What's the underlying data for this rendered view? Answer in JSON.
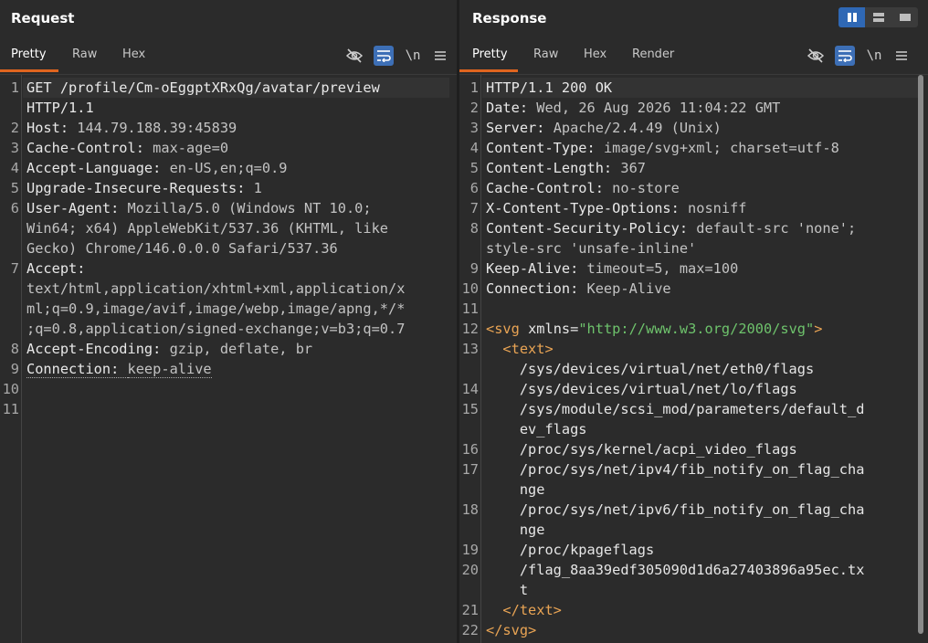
{
  "request": {
    "title": "Request",
    "tabs": [
      "Pretty",
      "Raw",
      "Hex"
    ],
    "newline_label": "\\n",
    "lines": [
      {
        "n": "1",
        "parts": [
          [
            "k",
            "GET /profile/Cm-oEggptXRxQg/avatar/preview"
          ]
        ]
      },
      {
        "n": "",
        "parts": [
          [
            "k",
            "HTTP/1.1"
          ]
        ]
      },
      {
        "n": "2",
        "parts": [
          [
            "k",
            "Host: "
          ],
          [
            "v",
            "144.79.188.39:45839"
          ]
        ]
      },
      {
        "n": "3",
        "parts": [
          [
            "k",
            "Cache-Control: "
          ],
          [
            "v",
            "max-age=0"
          ]
        ]
      },
      {
        "n": "4",
        "parts": [
          [
            "k",
            "Accept-Language: "
          ],
          [
            "v",
            "en-US,en;q=0.9"
          ]
        ]
      },
      {
        "n": "5",
        "parts": [
          [
            "k",
            "Upgrade-Insecure-Requests: "
          ],
          [
            "v",
            "1"
          ]
        ]
      },
      {
        "n": "6",
        "parts": [
          [
            "k",
            "User-Agent: "
          ],
          [
            "v",
            "Mozilla/5.0 (Windows NT 10.0;"
          ]
        ]
      },
      {
        "n": "",
        "parts": [
          [
            "v",
            "Win64; x64) AppleWebKit/537.36 (KHTML, like"
          ]
        ]
      },
      {
        "n": "",
        "parts": [
          [
            "v",
            "Gecko) Chrome/146.0.0.0 Safari/537.36"
          ]
        ]
      },
      {
        "n": "7",
        "parts": [
          [
            "k",
            "Accept:"
          ]
        ]
      },
      {
        "n": "",
        "parts": [
          [
            "v",
            "text/html,application/xhtml+xml,application/x"
          ]
        ]
      },
      {
        "n": "",
        "parts": [
          [
            "v",
            "ml;q=0.9,image/avif,image/webp,image/apng,*/*"
          ]
        ]
      },
      {
        "n": "",
        "parts": [
          [
            "v",
            ";q=0.8,application/signed-exchange;v=b3;q=0.7"
          ]
        ]
      },
      {
        "n": "8",
        "parts": [
          [
            "k",
            "Accept-Encoding: "
          ],
          [
            "v",
            "gzip, deflate, br"
          ]
        ]
      },
      {
        "n": "9",
        "parts": [
          [
            "kd",
            "Connection: "
          ],
          [
            "vd",
            "keep-alive"
          ]
        ]
      },
      {
        "n": "10",
        "parts": []
      },
      {
        "n": "11",
        "parts": []
      }
    ]
  },
  "response": {
    "title": "Response",
    "tabs": [
      "Pretty",
      "Raw",
      "Hex",
      "Render"
    ],
    "newline_label": "\\n",
    "lines": [
      {
        "n": "1",
        "parts": [
          [
            "k",
            "HTTP/1.1 200 OK"
          ]
        ]
      },
      {
        "n": "2",
        "parts": [
          [
            "k",
            "Date: "
          ],
          [
            "v",
            "Wed, 26 Aug 2026 11:04:22 GMT"
          ]
        ]
      },
      {
        "n": "3",
        "parts": [
          [
            "k",
            "Server: "
          ],
          [
            "v",
            "Apache/2.4.49 (Unix)"
          ]
        ]
      },
      {
        "n": "4",
        "parts": [
          [
            "k",
            "Content-Type: "
          ],
          [
            "v",
            "image/svg+xml; charset=utf-8"
          ]
        ]
      },
      {
        "n": "5",
        "parts": [
          [
            "k",
            "Content-Length: "
          ],
          [
            "v",
            "367"
          ]
        ]
      },
      {
        "n": "6",
        "parts": [
          [
            "k",
            "Cache-Control: "
          ],
          [
            "v",
            "no-store"
          ]
        ]
      },
      {
        "n": "7",
        "parts": [
          [
            "k",
            "X-Content-Type-Options: "
          ],
          [
            "v",
            "nosniff"
          ]
        ]
      },
      {
        "n": "8",
        "parts": [
          [
            "k",
            "Content-Security-Policy: "
          ],
          [
            "v",
            "default-src 'none';"
          ]
        ]
      },
      {
        "n": "",
        "parts": [
          [
            "v",
            "style-src 'unsafe-inline'"
          ]
        ]
      },
      {
        "n": "9",
        "parts": [
          [
            "k",
            "Keep-Alive: "
          ],
          [
            "v",
            "timeout=5, max=100"
          ]
        ]
      },
      {
        "n": "10",
        "parts": [
          [
            "k",
            "Connection: "
          ],
          [
            "v",
            "Keep-Alive"
          ]
        ]
      },
      {
        "n": "11",
        "parts": []
      },
      {
        "n": "12",
        "parts": [
          [
            "tag",
            "<svg "
          ],
          [
            "attr",
            "xmlns"
          ],
          [
            "txt",
            "="
          ],
          [
            "str",
            "\"http://www.w3.org/2000/svg\""
          ],
          [
            "tag",
            ">"
          ]
        ]
      },
      {
        "n": "13",
        "parts": [
          [
            "txt",
            "  "
          ],
          [
            "tag",
            "<text>"
          ]
        ]
      },
      {
        "n": "",
        "parts": [
          [
            "txt",
            "    /sys/devices/virtual/net/eth0/flags"
          ]
        ]
      },
      {
        "n": "14",
        "parts": [
          [
            "txt",
            "    /sys/devices/virtual/net/lo/flags"
          ]
        ]
      },
      {
        "n": "15",
        "parts": [
          [
            "txt",
            "    /sys/module/scsi_mod/parameters/default_d"
          ]
        ]
      },
      {
        "n": "",
        "parts": [
          [
            "txt",
            "    ev_flags"
          ]
        ]
      },
      {
        "n": "16",
        "parts": [
          [
            "txt",
            "    /proc/sys/kernel/acpi_video_flags"
          ]
        ]
      },
      {
        "n": "17",
        "parts": [
          [
            "txt",
            "    /proc/sys/net/ipv4/fib_notify_on_flag_cha"
          ]
        ]
      },
      {
        "n": "",
        "parts": [
          [
            "txt",
            "    nge"
          ]
        ]
      },
      {
        "n": "18",
        "parts": [
          [
            "txt",
            "    /proc/sys/net/ipv6/fib_notify_on_flag_cha"
          ]
        ]
      },
      {
        "n": "",
        "parts": [
          [
            "txt",
            "    nge"
          ]
        ]
      },
      {
        "n": "19",
        "parts": [
          [
            "txt",
            "    /proc/kpageflags"
          ]
        ]
      },
      {
        "n": "20",
        "parts": [
          [
            "txt",
            "    /flag_8aa39edf305090d1d6a27403896a95ec.tx"
          ]
        ]
      },
      {
        "n": "",
        "parts": [
          [
            "txt",
            "    t"
          ]
        ]
      },
      {
        "n": "21",
        "parts": [
          [
            "txt",
            "  "
          ],
          [
            "tag",
            "</text>"
          ]
        ]
      },
      {
        "n": "22",
        "parts": [
          [
            "tag",
            "</svg>"
          ]
        ]
      }
    ]
  }
}
